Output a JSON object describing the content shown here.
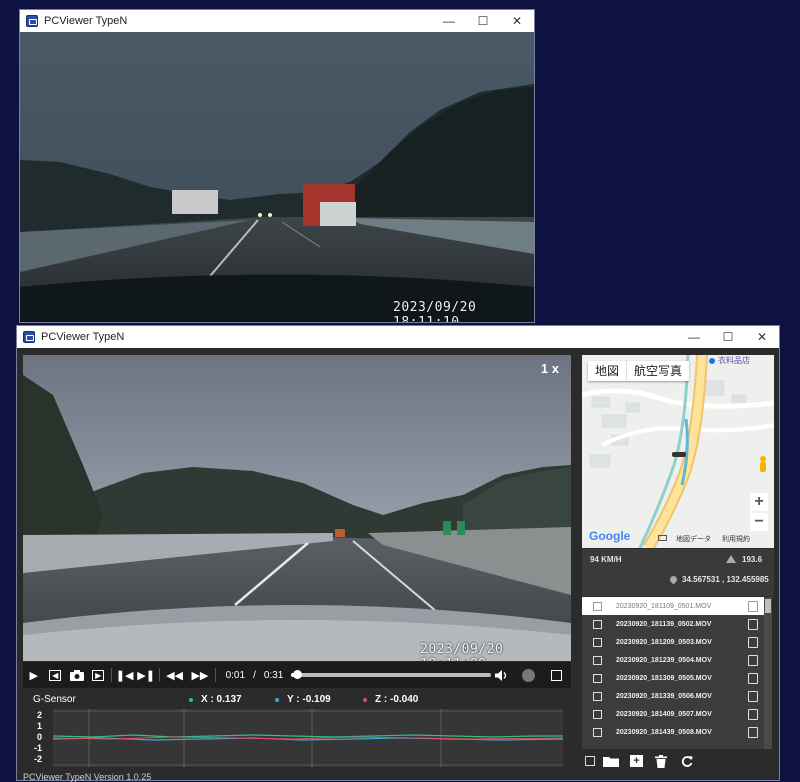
{
  "window1": {
    "title": "PCViewer TypeN",
    "minimize_glyph": "—",
    "maximize_glyph": "☐",
    "close_glyph": "✕",
    "timestamp": "2023/09/20  18:11:10"
  },
  "window2": {
    "title": "PCViewer TypeN",
    "minimize_glyph": "—",
    "maximize_glyph": "☐",
    "close_glyph": "✕",
    "video": {
      "speed": "1 x",
      "timestamp": "2023/09/20  18:11:09"
    },
    "controls": {
      "current_time": "0:01",
      "separator": "/",
      "duration": "0:31",
      "progress_fraction": 0.03,
      "icons": [
        "play-icon",
        "frame-back-icon",
        "camera-icon",
        "frame-forward-icon",
        "skip-previous-icon",
        "skip-next-icon",
        "rewind-icon",
        "fast-forward-icon",
        "volume-icon",
        "record-icon",
        "fullscreen-icon"
      ]
    },
    "gsensor": {
      "label": "G-Sensor",
      "x_label": "X : 0.137",
      "y_label": "Y : -0.109",
      "z_label": "Z : -0.040",
      "x_color": "#2ec27e",
      "y_color": "#3aa6d8",
      "z_color": "#e04b6a",
      "axis_ticks": [
        "2",
        "1",
        "0",
        "-1",
        "-2"
      ]
    },
    "map": {
      "tab_map": "地図",
      "tab_aerial": "航空写真",
      "top_label": "衣料品店",
      "zoom_in": "+",
      "zoom_out": "−",
      "google": "Google",
      "map_data": "地図データ",
      "terms": "利用規約"
    },
    "info": {
      "speed": "94  KM/H",
      "altitude": "193.6",
      "coordinates": "34.567531 , 132.455985"
    },
    "files": [
      {
        "name": "20230920_181109_0501.MOV",
        "selected": true
      },
      {
        "name": "20230920_181139_0502.MOV",
        "selected": false
      },
      {
        "name": "20230920_181209_0503.MOV",
        "selected": false
      },
      {
        "name": "20230920_181239_0504.MOV",
        "selected": false
      },
      {
        "name": "20230920_181309_0505.MOV",
        "selected": false
      },
      {
        "name": "20230920_181339_0506.MOV",
        "selected": false
      },
      {
        "name": "20230920_181409_0507.MOV",
        "selected": false
      },
      {
        "name": "20230920_181439_0508.MOV",
        "selected": false
      }
    ],
    "list_tools": [
      "select-all-checkbox-icon",
      "folder-icon",
      "add-icon",
      "trash-icon",
      "refresh-icon"
    ],
    "status": "PCViewer TypeN Version 1.0.25"
  }
}
